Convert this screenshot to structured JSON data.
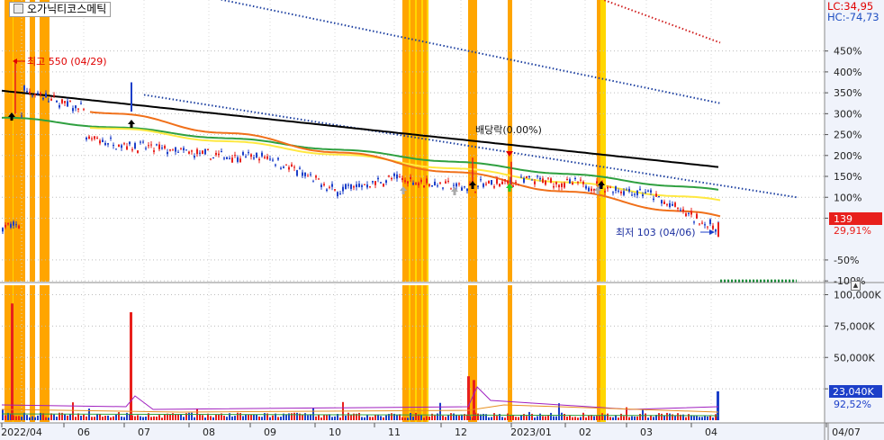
{
  "stock_name": "오가닉티코스메틱",
  "lc_label": "LC:34,95",
  "hc_label": "HC:-74,73",
  "price_badge": "139",
  "price_change": "29,91%",
  "volume_badge": "23,040K",
  "volume_pct": "92,52%",
  "annotations": {
    "high": "최고 550 (04/29)",
    "low": "최저 103 (04/06)",
    "dividend": "배당락(0.00%)"
  },
  "colors": {
    "up": "#e8201c",
    "down": "#1c3fc9",
    "highlight_orange": "#ffa500",
    "highlight_yellow": "#ffd700",
    "ma_orange": "#f0701a",
    "ma_yellow": "#ffe840",
    "ma_green": "#2fa040",
    "ma_black": "#000000",
    "band_blue": "#1c3fa0",
    "band_red": "#d02020",
    "axis_bg": "#f0f3fb",
    "gridline": "#bdbdbd"
  },
  "chart_data": [
    {
      "type": "line",
      "title": "",
      "y_axis": "percent",
      "y_ticks": [
        "450%",
        "400%",
        "350%",
        "300%",
        "250%",
        "200%",
        "150%",
        "100%",
        "50%",
        "-50%",
        "-100%"
      ],
      "x_ticks": [
        "2022/04",
        "06",
        "07",
        "08",
        "09",
        "10",
        "11",
        "12",
        "2023/01",
        "02",
        "03",
        "04"
      ],
      "highlight_bands": [
        {
          "color": "orange",
          "month": "2022/04"
        },
        {
          "color": "orange",
          "month": "2022/11"
        },
        {
          "color": "orange",
          "month": "2022/12"
        },
        {
          "color": "orange",
          "month": "2022/12"
        },
        {
          "color": "yellow",
          "month": "2023/02"
        }
      ],
      "series": [
        {
          "name": "",
          "color": "#000000",
          "pct_start": 355,
          "pct_end": 172
        },
        {
          "name": "",
          "color": "#2fa040",
          "pct_start": 290,
          "pct_end": 115
        },
        {
          "name": "",
          "color": "#ffe840",
          "pct_start": 270,
          "pct_end": 90
        },
        {
          "name": "",
          "color": "#f0701a",
          "pct_start": 310,
          "pct_end": 50
        }
      ],
      "bands": [
        {
          "name": "",
          "color": "#d02020",
          "pct_start": 640,
          "pct_end": 470
        },
        {
          "name": "",
          "color": "#1c3fa0",
          "pct_start": 580,
          "pct_end": 325
        },
        {
          "name": "",
          "color": "#1c3fa0",
          "pct_start": 345,
          "pct_end": 100
        },
        {
          "name": "",
          "color": "#1c8c3a",
          "pct_start": -100,
          "pct_end": -100
        }
      ],
      "price": [
        {
          "x": "2022/04",
          "pct": 300
        },
        {
          "x": "2022/04",
          "pct": 360
        },
        {
          "x": "2022/05",
          "pct": 330
        },
        {
          "x": "2022/06",
          "pct": 310
        },
        {
          "x": "2022/06",
          "pct": 240
        },
        {
          "x": "2022/07",
          "pct": 220
        },
        {
          "x": "2022/08",
          "pct": 200
        },
        {
          "x": "2022/09",
          "pct": 195
        },
        {
          "x": "2022/10",
          "pct": 115
        },
        {
          "x": "2022/11",
          "pct": 145
        },
        {
          "x": "2022/12",
          "pct": 125
        },
        {
          "x": "2023/01",
          "pct": 140
        },
        {
          "x": "2023/02",
          "pct": 130
        },
        {
          "x": "2023/03",
          "pct": 110
        },
        {
          "x": "2023/04",
          "pct": 30
        }
      ]
    },
    {
      "type": "bar",
      "title": "",
      "y_axis": "volume",
      "y_ticks": [
        "100,000K",
        "75,000K",
        "50,000K",
        "25,000K"
      ],
      "x_ticks": [
        "2022/04",
        "06",
        "07",
        "08",
        "09",
        "10",
        "11",
        "12",
        "2023/01",
        "02",
        "03",
        "04",
        "04/07"
      ],
      "spikes": [
        {
          "x": "2022/04",
          "value": 93000
        },
        {
          "x": "2022/07",
          "value": 86000
        },
        {
          "x": "2022/12",
          "value": 35000
        },
        {
          "x": "2022/12",
          "value": 32000
        },
        {
          "x": "2023/04",
          "value": 23040
        }
      ]
    }
  ]
}
